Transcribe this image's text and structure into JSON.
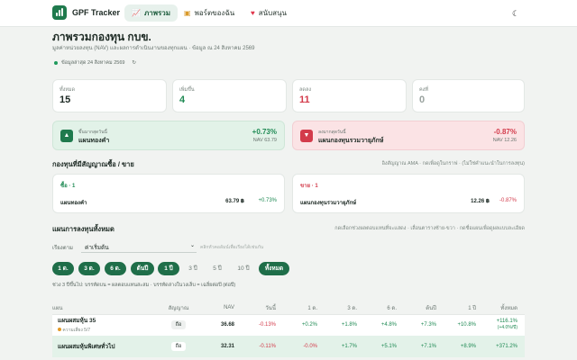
{
  "brand": "GPF Tracker",
  "nav": [
    {
      "label": "ภาพรวม",
      "icon": "chart-line-icon"
    },
    {
      "label": "พอร์ตของฉัน",
      "icon": "wallet-icon"
    },
    {
      "label": "สนับสนุน",
      "icon": "heart-icon"
    }
  ],
  "header": {
    "title": "ภาพรวมกองทุน กบข.",
    "subtitle": "มูลค่าหน่วยลงทุน (NAV) และผลการดำเนินงานของทุกแผน · ข้อมูล ณ 24 สิงหาคม 2569",
    "updated": "ข้อมูลล่าสุด 24 สิงหาคม 2569"
  },
  "stats": [
    {
      "label": "ทั้งหมด",
      "value": "15"
    },
    {
      "label": "เพิ่มขึ้น",
      "value": "4"
    },
    {
      "label": "ลดลง",
      "value": "11"
    },
    {
      "label": "คงที่",
      "value": "0"
    }
  ],
  "best": {
    "label": "ขึ้นมากสุดวันนี้",
    "name": "แผนทองคำ",
    "change": "+0.73%",
    "nav": "NAV 63.79"
  },
  "worst": {
    "label": "ลงมากสุดวันนี้",
    "name": "แผนกองทุนรวมวายุภักษ์",
    "change": "-0.87%",
    "nav": "NAV 12.26"
  },
  "signals": {
    "title": "กองทุนที่มีสัญญาณซื้อ / ขาย",
    "note": "อิงสัญญาณ AMA · กดเพื่อดูในกราฟ · (ไม่ใช่คำแนะนำในการลงทุน)",
    "buy": {
      "label": "ซื้อ · 1",
      "name": "แผนทองคำ",
      "nav": "63.79 ฿",
      "change": "+0.73%"
    },
    "sell": {
      "label": "ขาย · 1",
      "name": "แผนกองทุนรวมวายุภักษ์",
      "nav": "12.26 ฿",
      "change": "-0.87%"
    }
  },
  "plans": {
    "title": "แผนการลงทุนทั้งหมด",
    "note": "กดเลือกช่วงผลตอบแทนที่จะแสดง · เลื่อนตารางซ้าย-ขวา · กดชื่อแผนเพื่อดูผลแบบละเอียด",
    "sort_label": "เรียงตาม",
    "sort_value": "ค่าเริ่มต้น",
    "sort_hint": "คลิกหัวคอลัมน์เพื่อเรียงได้เช่นกัน",
    "periods": [
      "1 ด.",
      "3 ด.",
      "6 ด.",
      "ต้นปี",
      "1 ปี",
      "3 ปี",
      "5 ปี",
      "10 ปี",
      "ทั้งหมด"
    ],
    "legend": "ช่วง 3 ปีขึ้นไป: บรรทัดบน = ผลตอบแทนสะสม · บรรทัดล่างในวงเล็บ = เฉลี่ยต่อปี (ต่อปี)"
  },
  "table": {
    "headers": [
      "แผน",
      "สัญญาณ",
      "NAV",
      "วันนี้",
      "1 ด.",
      "3 ด.",
      "6 ด.",
      "ต้นปี",
      "1 ปี",
      "ทั้งหมด"
    ],
    "rows": [
      {
        "name": "แผนผสมหุ้น 35",
        "risk": "ความเสี่ยง 5/7",
        "signal": "ถือ",
        "nav": "36.68",
        "today": "-0.13%",
        "m1": "+0.2%",
        "m3": "+1.8%",
        "m6": "+4.8%",
        "ytd": "+7.3%",
        "y1": "+10.8%",
        "all": "+116.1%",
        "all2": "(+4.0%/ปี)"
      },
      {
        "name": "แผนผสมหุ้นพิเศษทั่วไป",
        "risk": "",
        "signal": "ถือ",
        "nav": "32.31",
        "today": "-0.11%",
        "m1": "-0.0%",
        "m3": "+1.7%",
        "m6": "+5.1%",
        "ytd": "+7.1%",
        "y1": "+8.9%",
        "all": "+371.2%",
        "all2": ""
      }
    ]
  }
}
